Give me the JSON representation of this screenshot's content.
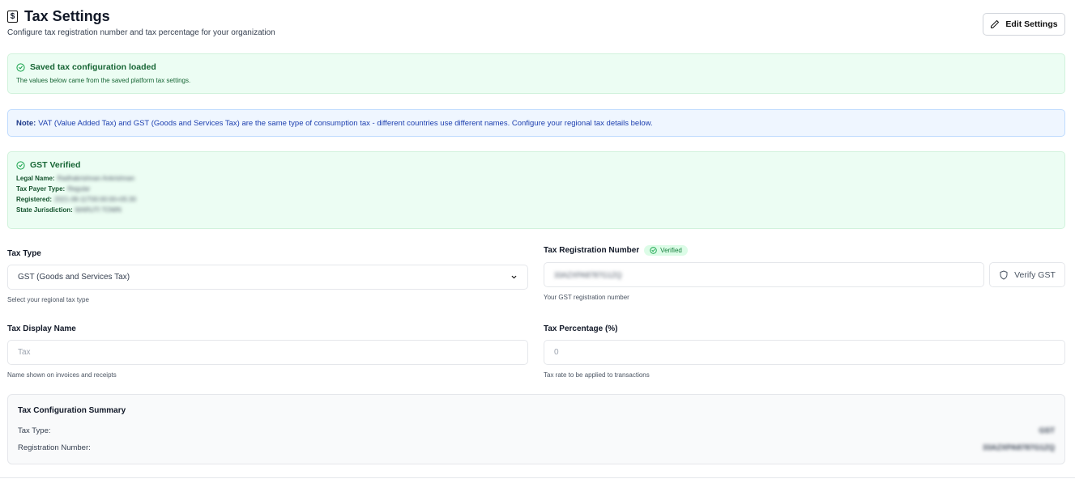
{
  "header": {
    "title": "Tax Settings",
    "subtitle": "Configure tax registration number and tax percentage for your organization",
    "edit_label": "Edit Settings"
  },
  "alerts": {
    "saved": {
      "title": "Saved tax configuration loaded",
      "description": "The values below came from the saved platform tax settings."
    },
    "note": {
      "prefix": "Note:",
      "text": "VAT (Value Added Tax) and GST (Goods and Services Tax) are the same type of consumption tax - different countries use different names. Configure your regional tax details below."
    },
    "gst": {
      "title": "GST Verified",
      "legal_name_label": "Legal Name:",
      "legal_name_value": "Radhakrishnan Ankrishnan",
      "taxpayer_label": "Tax Payer Type:",
      "taxpayer_value": "Regular",
      "registered_label": "Registered:",
      "registered_value": "2021-08-11T00:00:00+05:30",
      "jurisdiction_label": "State Jurisdiction:",
      "jurisdiction_value": "MARUTI TOWN"
    }
  },
  "form": {
    "tax_type": {
      "label": "Tax Type",
      "value": "GST (Goods and Services Tax)",
      "hint": "Select your regional tax type"
    },
    "registration": {
      "label": "Tax Registration Number",
      "badge": "Verified",
      "value": "33AZXPA8787G1ZQ",
      "hint": "Your GST registration number",
      "verify_label": "Verify GST"
    },
    "display_name": {
      "label": "Tax Display Name",
      "placeholder": "Tax",
      "hint": "Name shown on invoices and receipts"
    },
    "percentage": {
      "label": "Tax Percentage (%)",
      "placeholder": "0",
      "hint": "Tax rate to be applied to transactions"
    }
  },
  "summary": {
    "title": "Tax Configuration Summary",
    "rows": [
      {
        "label": "Tax Type:",
        "value": "GST"
      },
      {
        "label": "Registration Number:",
        "value": "33AZXPA8787G1ZQ"
      }
    ]
  },
  "colors": {
    "success_bg": "#ecfdf3",
    "success_text": "#166534",
    "info_bg": "#eff6ff",
    "info_text": "#1e40af"
  }
}
